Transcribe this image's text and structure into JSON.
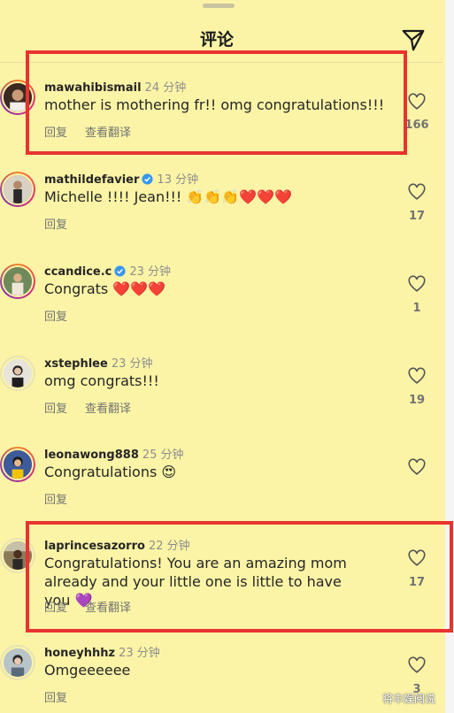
{
  "header": {
    "title": "评论"
  },
  "actions_labels": {
    "reply": "回复",
    "translate": "查看翻译"
  },
  "comments": [
    {
      "username": "mawahibismail",
      "time": "24 分钟",
      "text": "mother is mothering fr!! omg congratulations!!!",
      "likes": "166",
      "verified": false,
      "has_translate": true
    },
    {
      "username": "mathildefavier",
      "time": "13 分钟",
      "text": "Michelle !!!! Jean!!! 👏👏👏❤️❤️❤️",
      "likes": "17",
      "verified": true,
      "has_translate": false
    },
    {
      "username": "ccandice.c",
      "time": "23 分钟",
      "text": "Congrats ❤️❤️❤️",
      "likes": "1",
      "verified": true,
      "has_translate": false
    },
    {
      "username": "xstephlee",
      "time": "23 分钟",
      "text": "omg congrats!!!",
      "likes": "19",
      "verified": false,
      "has_translate": true
    },
    {
      "username": "leonawong888",
      "time": "25 分钟",
      "text": "Congratulations 😍",
      "likes": "",
      "verified": false,
      "has_translate": false
    },
    {
      "username": "laprincesazorro",
      "time": "22 分钟",
      "text": "Congratulations! You are an amazing mom already and your little one is little to have you 💜",
      "likes": "17",
      "verified": false,
      "has_translate": true
    },
    {
      "username": "honeyhhhz",
      "time": "23 分钟",
      "text": "Omgeeeeee",
      "likes": "3",
      "verified": false,
      "has_translate": false
    }
  ],
  "watermark": "将丰娱阅说",
  "colors": {
    "background": "#fbf4a6",
    "highlight": "#e8332f",
    "heart_red": "#e0312b"
  }
}
